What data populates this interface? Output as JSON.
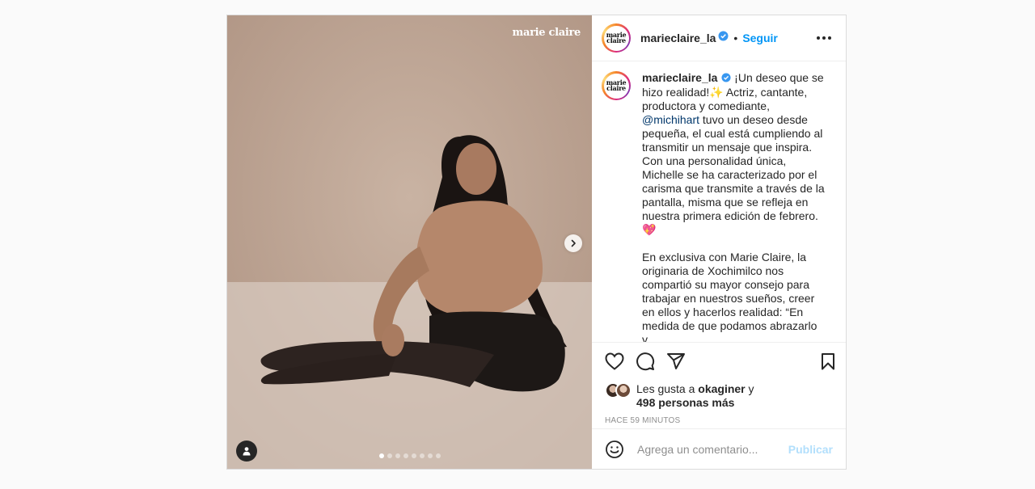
{
  "post": {
    "watermark": "marie claire",
    "avatar_text_line1": "marie",
    "avatar_text_line2": "claire",
    "username": "marieclaire_la",
    "separator": "•",
    "follow_label": "Seguir",
    "carousel": {
      "total": 8,
      "active": 1
    },
    "caption": {
      "username": "marieclaire_la",
      "para1_part1": " ¡Un deseo que se hizo realidad!✨ Actriz, cantante, productora y comediante, ",
      "mention": "@michihart",
      "para1_part2": " tuvo un deseo desde pequeña, el cual está cumpliendo al transmitir un mensaje que inspira. Con una personalidad única, Michelle se ha caracterizado por el carisma que transmite a través de la pantalla, misma que se refleja en nuestra primera edición de febrero. 💖",
      "para2": "En exclusiva con Marie Claire, la originaria de Xochimilco nos compartió su mayor consejo para trabajar en nuestros sueños, creer en ellos y hacerlos realidad: “En medida de que podamos abrazarlo y"
    },
    "likes": {
      "prefix": "Les gusta a ",
      "user": "okaginer",
      "conj": " y",
      "others": "498 personas más"
    },
    "timestamp": "HACE 59 MINUTOS",
    "comment_placeholder": "Agrega un comentario...",
    "publish_label": "Publicar"
  },
  "icons": {
    "like": "heart-icon",
    "comment": "comment-icon",
    "share": "paper-plane-icon",
    "save": "bookmark-icon",
    "emoji": "emoji-icon",
    "tag": "user-tag-icon",
    "next": "chevron-right-icon",
    "verified": "verified-badge-icon"
  },
  "colors": {
    "accent": "#0095f6",
    "publish_disabled": "#b2dffc",
    "muted": "#8e8e8e"
  }
}
